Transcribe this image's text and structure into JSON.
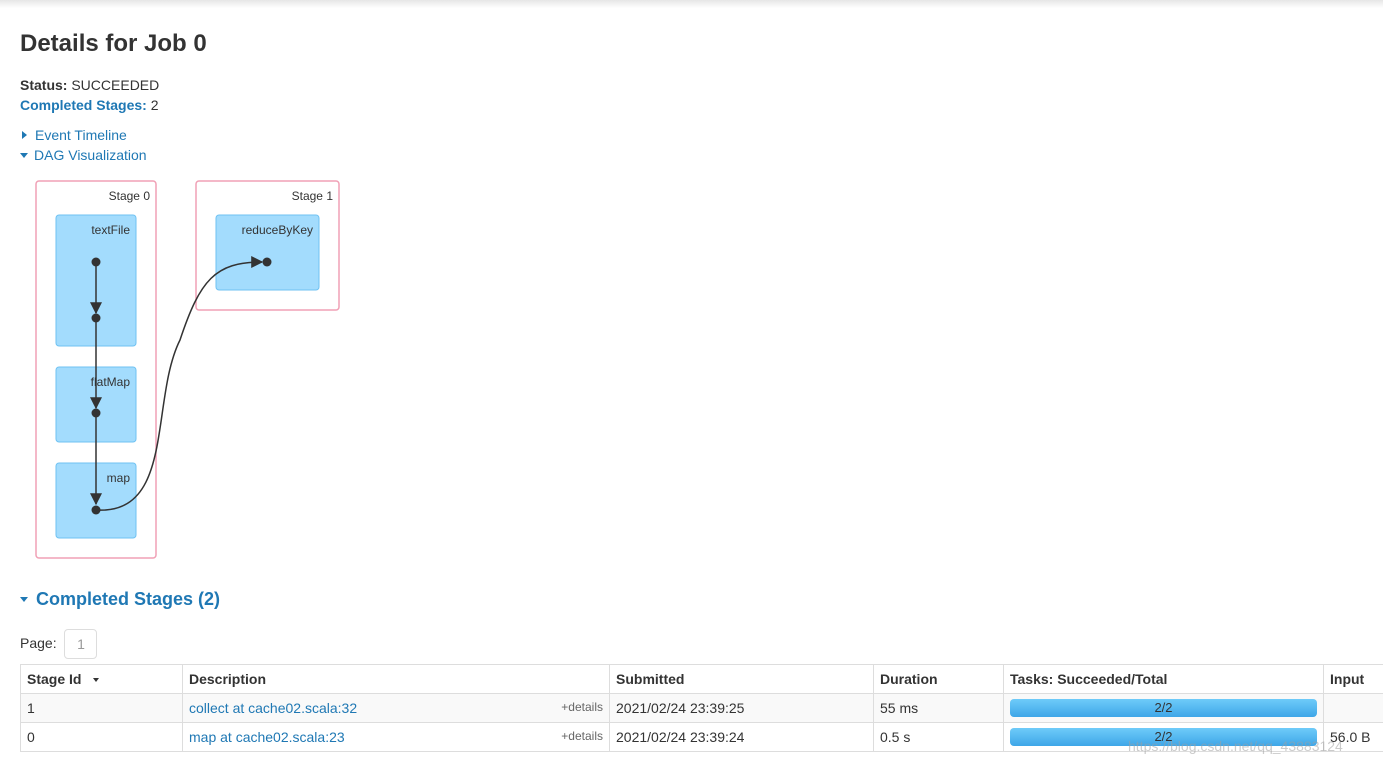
{
  "page": {
    "title": "Details for Job 0"
  },
  "summary": {
    "status_label": "Status:",
    "status_value": "SUCCEEDED",
    "completed_label": "Completed Stages:",
    "completed_value": "2"
  },
  "toggles": {
    "event_timeline": "Event Timeline",
    "dag_visualization": "DAG Visualization"
  },
  "dag": {
    "stages": [
      {
        "label": "Stage 0",
        "operations": [
          "textFile",
          "flatMap",
          "map"
        ]
      },
      {
        "label": "Stage 1",
        "operations": [
          "reduceByKey"
        ]
      }
    ]
  },
  "completed_stages": {
    "title": "Completed Stages (2)",
    "page_label": "Page:",
    "page_value": "1",
    "columns": [
      "Stage Id",
      "Description",
      "Submitted",
      "Duration",
      "Tasks: Succeeded/Total",
      "Input"
    ],
    "rows": [
      {
        "stage_id": "1",
        "description": "collect at cache02.scala:32",
        "details": "+details",
        "submitted": "2021/02/24 23:39:25",
        "duration": "55 ms",
        "tasks": "2/2",
        "tasks_progress": 1.0,
        "input": ""
      },
      {
        "stage_id": "0",
        "description": "map at cache02.scala:23",
        "details": "+details",
        "submitted": "2021/02/24 23:39:24",
        "duration": "0.5 s",
        "tasks": "2/2",
        "tasks_progress": 1.0,
        "input": "56.0 B"
      }
    ]
  },
  "watermark": "https://blog.csdn.net/qq_43883124",
  "colors": {
    "link": "#1f78b4",
    "stage_border": "#f0a0b5",
    "operation_fill": "#a3dcfd",
    "progress_fill": "#3ea6e8"
  }
}
